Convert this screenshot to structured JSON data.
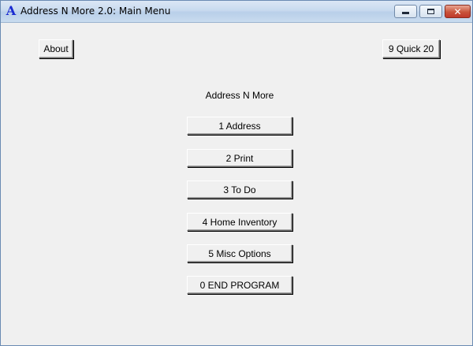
{
  "window": {
    "title": "Address N More 2.0: Main Menu",
    "app_icon_letter": "A",
    "icon": "app-icon",
    "controls": {
      "minimize_icon": "minimize-icon",
      "maximize_icon": "maximize-icon",
      "close_icon": "close-icon",
      "close_glyph": "✕"
    }
  },
  "toolbar": {
    "about_label": "About",
    "quick_label": "9 Quick 20"
  },
  "main": {
    "heading": "Address N More",
    "menu_items": [
      {
        "label": "1 Address"
      },
      {
        "label": "2 Print"
      },
      {
        "label": "3 To Do"
      },
      {
        "label": "4 Home Inventory"
      },
      {
        "label": "5 Misc Options"
      },
      {
        "label": "0 END PROGRAM"
      }
    ]
  },
  "colors": {
    "window_bg": "#f0f0f0",
    "title_gradient_top": "#dbe7f5",
    "icon_blue": "#1a2bd1",
    "close_red": "#c0392b"
  }
}
